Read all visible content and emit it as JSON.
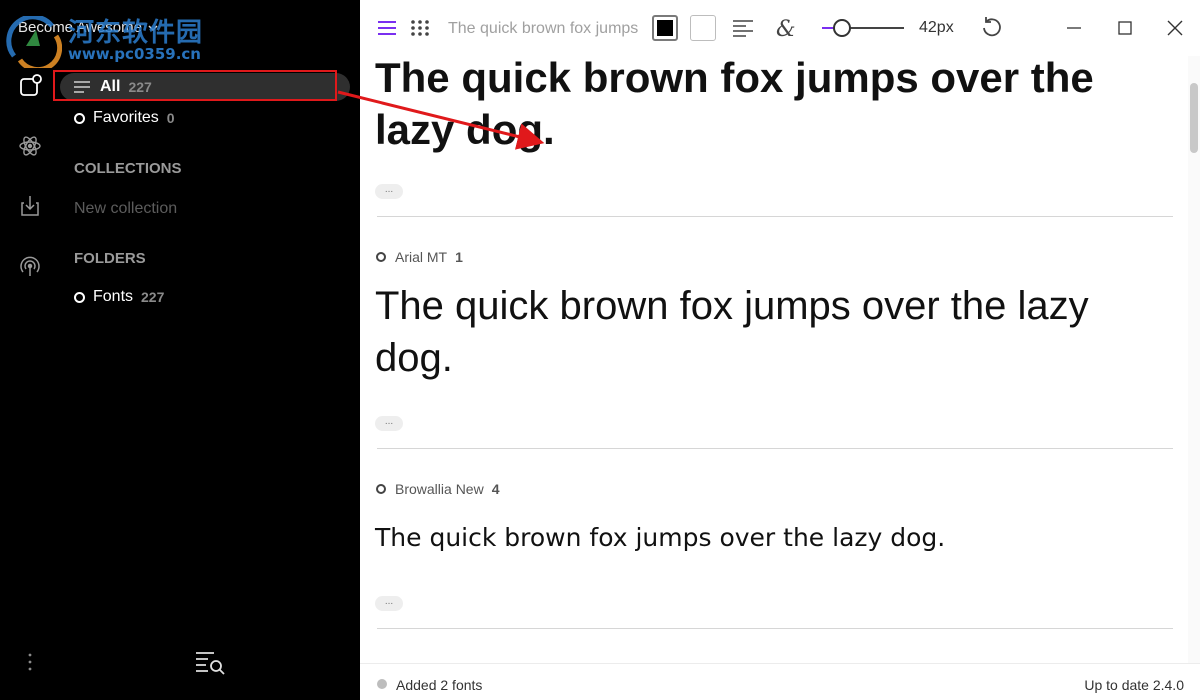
{
  "app": {
    "workspace_title": "Become Awesome",
    "watermark": {
      "line1": "河东软件园",
      "line2": "www.pc0359.cn"
    }
  },
  "colors": {
    "accent": "#7a2ff0",
    "highlight": "#e0191b",
    "sidebar_bg": "#000000"
  },
  "rail": {
    "icons": [
      "library-icon",
      "atom-icon",
      "import-icon",
      "broadcast-icon",
      "more-vertical-icon"
    ]
  },
  "sidebar": {
    "all": {
      "label": "All",
      "count": "227"
    },
    "favorites": {
      "label": "Favorites",
      "count": "0"
    },
    "collections_heading": "COLLECTIONS",
    "new_collection": "New collection",
    "folders_heading": "FOLDERS",
    "fonts_folder": {
      "label": "Fonts",
      "count": "227"
    }
  },
  "toolbar": {
    "preview_text": "The quick brown fox jumps over the lazy dog.",
    "text_color": "#000000",
    "background_color": "#ffffff",
    "font_size_label": "42px",
    "font_size_level": 0.22
  },
  "fonts": [
    {
      "name": "",
      "count": "",
      "sample": "The quick brown fox jumps over the lazy dog.",
      "more": "..."
    },
    {
      "name": "Arial MT",
      "count": "1",
      "sample": "The quick brown fox jumps over the lazy dog.",
      "more": "..."
    },
    {
      "name": "Browallia New",
      "count": "4",
      "sample": "The quick brown fox jumps over the lazy dog.",
      "more": "..."
    }
  ],
  "status": {
    "left": "Added 2 fonts",
    "right": "Up to date 2.4.0"
  }
}
